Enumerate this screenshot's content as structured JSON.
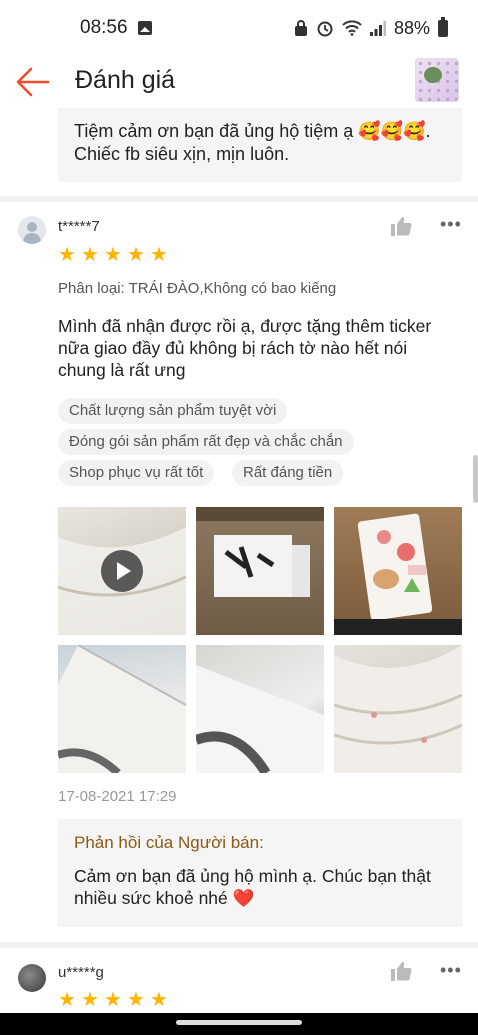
{
  "status_bar": {
    "time": "08:56",
    "battery": "88%"
  },
  "header": {
    "title": "Đánh giá"
  },
  "previous_reply": {
    "text": "Tiệm cảm ơn bạn đã ủng hộ tiệm ạ 🥰🥰🥰. Chiếc fb siêu xịn, mịn luôn."
  },
  "review": {
    "username": "t*****7",
    "stars": 5,
    "variation": "Phân loại: TRÁI ĐÀO,Không có bao kiếng",
    "text": "Mình đã nhận được rồi ạ, được tặng thêm ticker nữa giao đầy đủ không bị rách tờ nào hết nói chung là rất ưng",
    "tags": [
      "Chất lượng sản phẩm tuyệt vời",
      "Đóng gói sản phẩm rất đẹp và chắc chắn",
      "Shop phục vụ rất tốt",
      "Rất đáng tiền"
    ],
    "media": [
      {
        "kind": "video",
        "icon": "play-icon"
      },
      {
        "kind": "photo"
      },
      {
        "kind": "photo"
      },
      {
        "kind": "photo"
      },
      {
        "kind": "photo"
      },
      {
        "kind": "photo"
      }
    ],
    "timestamp": "17-08-2021 17:29",
    "seller_reply": {
      "title": "Phản hồi của Người bán:",
      "text": "Cảm ơn bạn đã ủng hộ mình ạ. Chúc bạn thật nhiều sức khoẻ nhé",
      "emoji": "❤️"
    }
  },
  "next_review": {
    "username": "u*****g",
    "stars": 5
  },
  "colors": {
    "accent": "#ee4d2d",
    "star": "#ffb400",
    "seller_title": "#8a5a12"
  }
}
